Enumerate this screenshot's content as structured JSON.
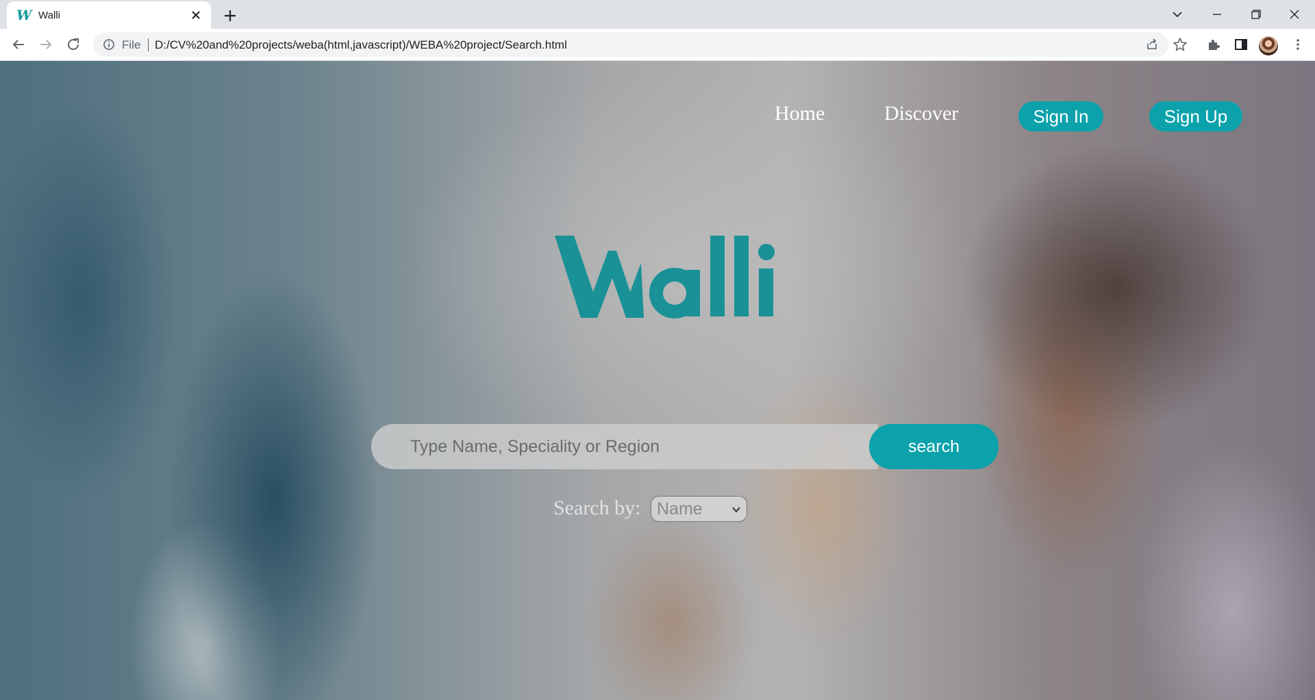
{
  "browser": {
    "tab": {
      "title": "Walli",
      "favicon_letter": "W"
    },
    "omnibox": {
      "scheme_label": "File",
      "url": "D:/CV%20and%20projects/weba(html,javascript)/WEBA%20project/Search.html"
    }
  },
  "nav": {
    "home": "Home",
    "discover": "Discover",
    "sign_in": "Sign In",
    "sign_up": "Sign Up"
  },
  "logo": {
    "text": "Walli",
    "color": "#1a9196"
  },
  "search": {
    "placeholder": "Type Name, Speciality or Region",
    "button_label": "search",
    "by_label": "Search by:",
    "by_selected": "Name"
  },
  "colors": {
    "accent": "#0ca2ab"
  }
}
